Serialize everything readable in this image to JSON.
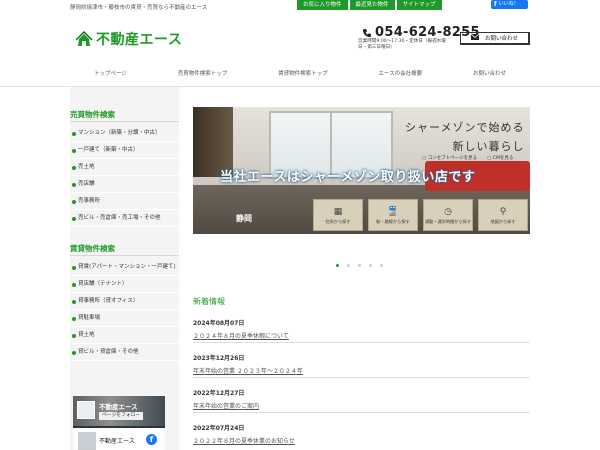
{
  "header": {
    "tagline": "静岡県焼津市・藤枝市の賃貸・売買なら不動産のエース",
    "top_links": [
      "お気に入り物件",
      "最近見た物件",
      "サイトマップ"
    ],
    "like_label": "いいね！",
    "logo_text": "不動産エース",
    "phone": "054-624-8255",
    "hours": "営業時間9:00～17:30・定休日（毎週水曜日・第三日曜日）",
    "contact_label": "お問い合わせ"
  },
  "nav": [
    "トップページ",
    "売買物件検索トップ",
    "賃貸物件検索トップ",
    "エースの会社概要",
    "お問い合わせ"
  ],
  "sidebar": {
    "sale_title": "売買物件検索",
    "sale_items": [
      "マンション（新築・分譲・中古）",
      "一戸建て（新築・中古）",
      "売土地",
      "売店舗",
      "売事務所",
      "売ビル・売倉庫・売工場・その他"
    ],
    "rent_title": "賃貸物件検索",
    "rent_items": [
      "貸賃(アパート・マンション・一戸建て)",
      "貸店舗（テナント）",
      "貸事務所（貸オフィス）",
      "貸駐車場",
      "貸土地",
      "貸ビル・貸倉庫・その他"
    ],
    "fb_page_name": "不動産エース",
    "fb_follow_label": "ページをフォロー"
  },
  "hero": {
    "headline_1": "シャーメゾンで始める",
    "headline_2": "新しい暮らし",
    "concept_link": "コンセプトページを見る",
    "cm_link": "CMを見る",
    "banner": "当社エースはシャーメゾン取り扱い店です",
    "city": "静岡",
    "cards": [
      {
        "icon": "building-icon",
        "label": "住所から探す"
      },
      {
        "icon": "train-icon",
        "label": "駅・路線から探す"
      },
      {
        "icon": "clock-icon",
        "label": "通勤・通学時間から探す"
      },
      {
        "icon": "map-pin-icon",
        "label": "地図から探す"
      }
    ],
    "slides_total": 5,
    "active_slide": 1
  },
  "news": {
    "heading": "新着情報",
    "items": [
      {
        "date": "2024年08月07日",
        "title": "２０２４年８月の夏季休暇について"
      },
      {
        "date": "2023年12月26日",
        "title": "年末年始の営業 ２０２３年～２０２４年"
      },
      {
        "date": "2022年12月27日",
        "title": "年末年始の営業のご案内"
      },
      {
        "date": "2022年07月24日",
        "title": "２０２２年８月の夏季休業のお知らせ"
      }
    ]
  },
  "colors": {
    "brand_green": "#1f9a28",
    "facebook_blue": "#1877f2"
  }
}
